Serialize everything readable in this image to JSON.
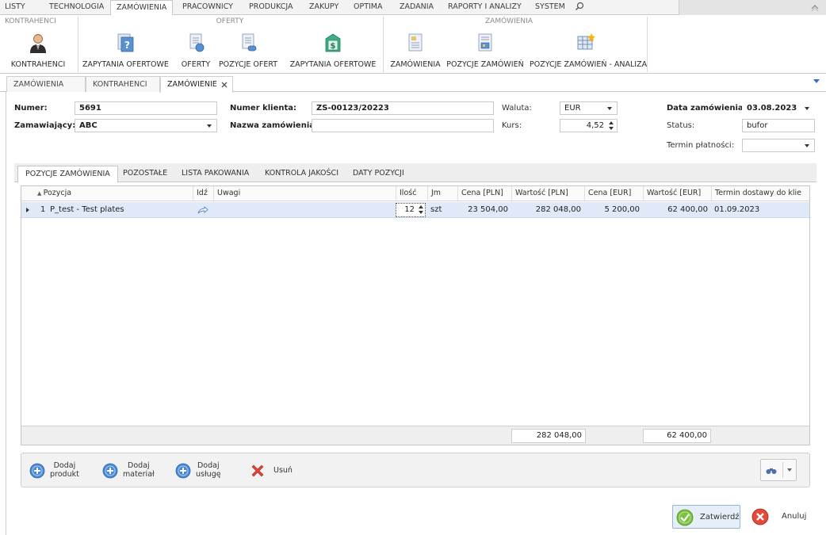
{
  "menu": {
    "items": [
      "LISTY",
      "TECHNOLOGIA",
      "ZAMÓWIENIA",
      "PRACOWNICY",
      "PRODUKCJA",
      "ZAKUPY",
      "OPTIMA",
      "ZADANIA",
      "RAPORTY I ANALIZY",
      "SYSTEM"
    ],
    "active": "ZAMÓWIENIA"
  },
  "ribbon": {
    "groups": {
      "kontrahenci": "KONTRAHENCI",
      "oferty": "OFERTY",
      "zamowienia": "ZAMÓWIENIA"
    },
    "buttons": {
      "kontrahenci": "KONTRAHENCI",
      "zapytania_ofertowe_1": "ZAPYTANIA OFERTOWE",
      "oferty": "OFERTY",
      "pozycje_ofert": "POZYCJE OFERT",
      "zapytania_ofertowe_2": "ZAPYTANIA OFERTOWE",
      "zamowienia": "ZAMÓWIENIA",
      "pozycje_zamowien": "POZYCJE ZAMÓWIEŃ",
      "pozycje_zamowien_analiza": "POZYCJE ZAMÓWIEŃ - ANALIZA"
    }
  },
  "doc_tabs": {
    "tab1": "ZAMÓWIENIA",
    "tab2": "KONTRAHENCI",
    "tab3": "ZAMÓWIENIE"
  },
  "form": {
    "numer_label": "Numer:",
    "numer_value": "5691",
    "zamawiajacy_label": "Zamawiający:",
    "zamawiajacy_value": "ABC",
    "numer_klienta_label": "Numer klienta:",
    "numer_klienta_value": "ZS-00123/20223",
    "nazwa_zamowienia_label": "Nazwa zamówienia:",
    "nazwa_zamowienia_value": "",
    "waluta_label": "Waluta:",
    "waluta_value": "EUR",
    "kurs_label": "Kurs:",
    "kurs_value": "4,52",
    "data_label": "Data zamówienia:",
    "data_value": "03.08.2023",
    "status_label": "Status:",
    "status_value": "bufor",
    "termin_label": "Termin płatności:",
    "termin_value": ""
  },
  "inner_tabs": {
    "pozycje": "POZYCJE ZAMÓWIENIA",
    "pozostale": "POZOSTAŁE",
    "lista": "LISTA PAKOWANIA",
    "kontrola": "KONTROLA JAKOŚCI",
    "daty": "DATY POZYCJI"
  },
  "grid": {
    "headers": {
      "pozycja": "Pozycja",
      "idz": "Idź",
      "uwagi": "Uwagi",
      "ilosc": "Ilość",
      "jm": "Jm",
      "cena_pln": "Cena [PLN]",
      "wartosc_pln": "Wartość [PLN]",
      "cena_eur": "Cena [EUR]",
      "wartosc_eur": "Wartość [EUR]",
      "termin": "Termin dostawy do klie..."
    },
    "rows": [
      {
        "lp": "1",
        "pozycja": "P_test - Test plates",
        "uwagi": "",
        "ilosc": "12",
        "jm": "szt",
        "cena_pln": "23 504,00",
        "wartosc_pln": "282 048,00",
        "cena_eur": "5 200,00",
        "wartosc_eur": "62 400,00",
        "termin": "01.09.2023"
      }
    ],
    "totals": {
      "wartosc_pln": "282 048,00",
      "wartosc_eur": "62 400,00"
    }
  },
  "actions": {
    "dodaj_produkt": [
      "Dodaj",
      "produkt"
    ],
    "dodaj_material": [
      "Dodaj",
      "materiał"
    ],
    "dodaj_usluge": [
      "Dodaj",
      "usługę"
    ],
    "usun": "Usuń"
  },
  "footer": {
    "zatwierdz": "Zatwierdź",
    "anuluj": "Anuluj"
  },
  "colors": {
    "selected_row": "#dfe9f8",
    "accent_blue": "#3a6fbf",
    "ok_green": "#6fbf3a",
    "cancel_red": "#e24a3a"
  }
}
